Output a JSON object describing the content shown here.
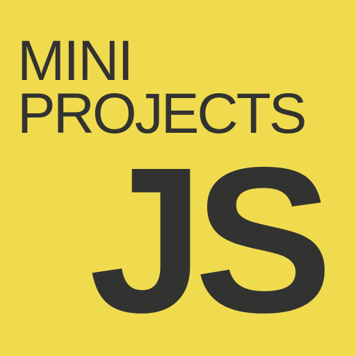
{
  "brand": {
    "line1": "MINI",
    "line2": "PROJECTS",
    "line3": "JS"
  },
  "colors": {
    "background": "#F0DB4F",
    "text": "#323330"
  }
}
